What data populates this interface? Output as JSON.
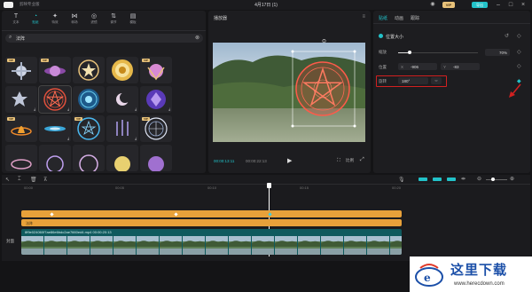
{
  "titlebar": {
    "app_name": "剪映专业版",
    "window_title": "4月17日 (1)",
    "vip_label": "VIP",
    "export_label": "导出"
  },
  "left_tabs": [
    {
      "label": "文本",
      "icon": "text-icon"
    },
    {
      "label": "贴纸",
      "icon": "sticker-icon"
    },
    {
      "label": "特效",
      "icon": "effects-icon"
    },
    {
      "label": "转场",
      "icon": "transition-icon"
    },
    {
      "label": "滤镜",
      "icon": "filter-icon"
    },
    {
      "label": "调节",
      "icon": "adjust-icon"
    },
    {
      "label": "模板",
      "icon": "template-icon"
    }
  ],
  "search": {
    "value": "法阵"
  },
  "vip_tag": "VIP",
  "player": {
    "header": "播放器",
    "current_time": "00:00:13:11",
    "total_time": "00:00:22:13",
    "ratio_label": "比例"
  },
  "right_panel": {
    "tabs": [
      "贴纸",
      "动画",
      "跟踪"
    ],
    "section_title": "位置大小",
    "scale_label": "缩放",
    "scale_value": "70%",
    "position_label": "位置",
    "pos_x_prefix": "X",
    "pos_x": "-906",
    "pos_y_prefix": "Y",
    "pos_y": "-83",
    "rotate_label": "旋转",
    "rotate_value": "180°"
  },
  "timeline": {
    "ruler": [
      "00:00",
      "00:05",
      "00:10",
      "00:15",
      "00:20"
    ],
    "sticker_track_label": "法阵",
    "video_clip_label": "8f9e024060f7ae86e6bdc2ae7660ed4.mp4  00:00:20:13",
    "cover_label": "封面"
  },
  "watermark": {
    "brand": "这里下载",
    "url": "www.herecdown.com"
  },
  "colors": {
    "accent": "#22c2c9",
    "sticker_track": "#e8a13a",
    "vip_gold": "#e8c27a",
    "highlight_box": "#d22020"
  }
}
